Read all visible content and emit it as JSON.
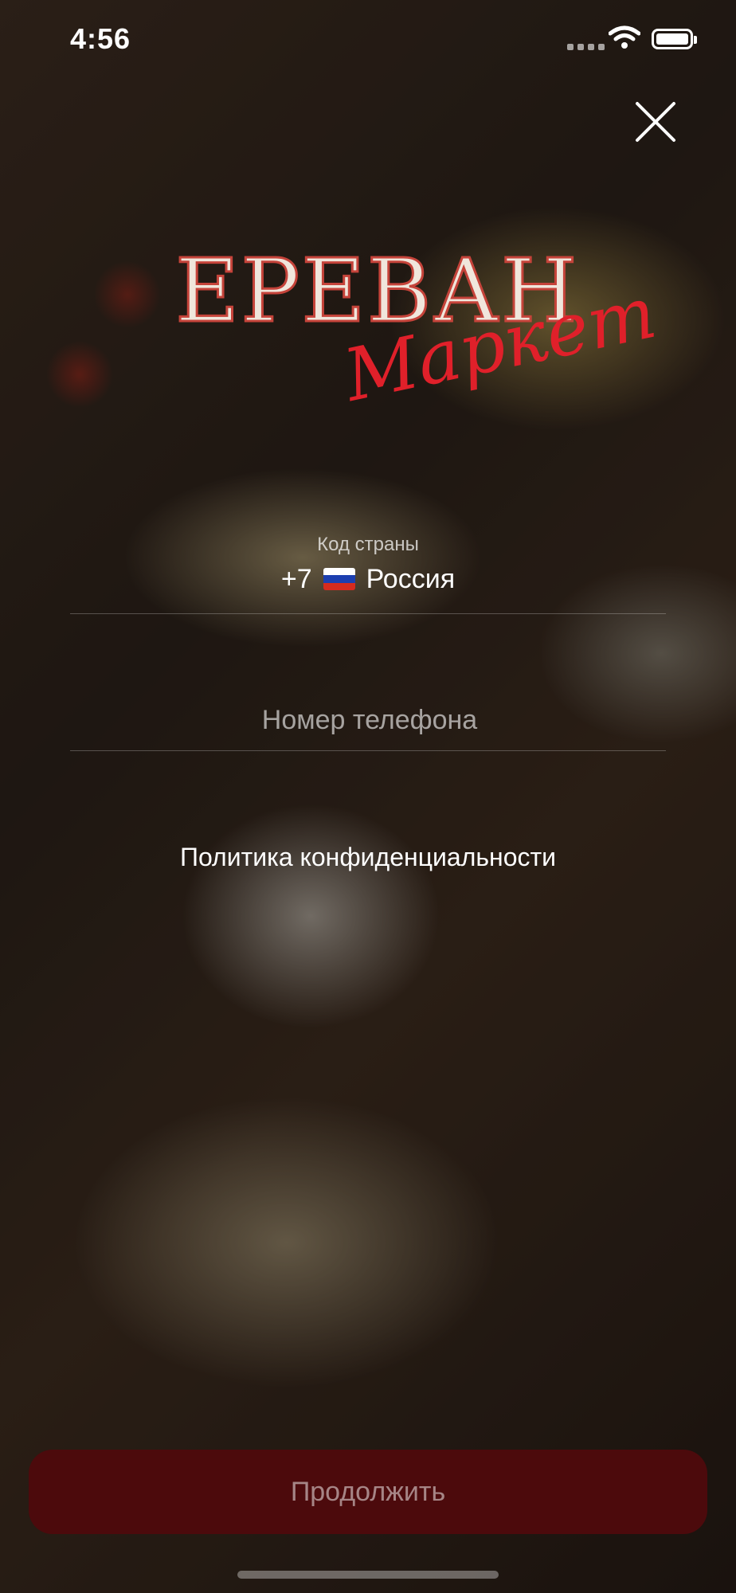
{
  "status_bar": {
    "time": "4:56"
  },
  "logo": {
    "main": "ЕРЕВАН",
    "sub": "Маркет"
  },
  "country": {
    "label": "Код страны",
    "code": "+7",
    "name": "Россия"
  },
  "phone": {
    "placeholder": "Номер телефона"
  },
  "privacy_link": "Политика конфиденциальности",
  "continue_label": "Продолжить",
  "colors": {
    "button_bg": "#4c0a0c",
    "logo_red": "#e0202a"
  }
}
